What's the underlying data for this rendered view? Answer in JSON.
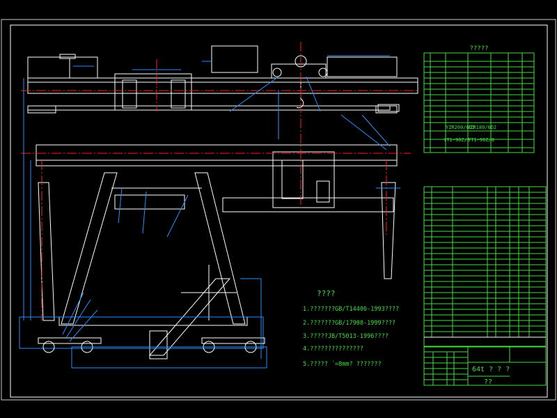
{
  "drawing": {
    "colors": {
      "background": "#000000",
      "geometry": "#ffffff",
      "centerline": "#ff2020",
      "leader": "#2a8fff",
      "text": "#3fe03f",
      "frame": "#7fd8ff"
    },
    "spec_table": {
      "title": "?????",
      "motor_left": "YZR200/6D2",
      "motor_right": "YZR180/6D2",
      "brake_left": "YT1-90Z/8",
      "brake_right": "YT1-90Z/8"
    },
    "notes": {
      "title": "????",
      "items": [
        "1.???????GB/T14406-1993????",
        "2.???????GB/17908-1999????",
        "3.?????JB/T5013-1996????",
        "4.???????????????",
        "5.?????  ´=8mm?  ???????"
      ]
    },
    "title_block": {
      "name": "64t ? ? ?",
      "subtitle": "??"
    }
  }
}
